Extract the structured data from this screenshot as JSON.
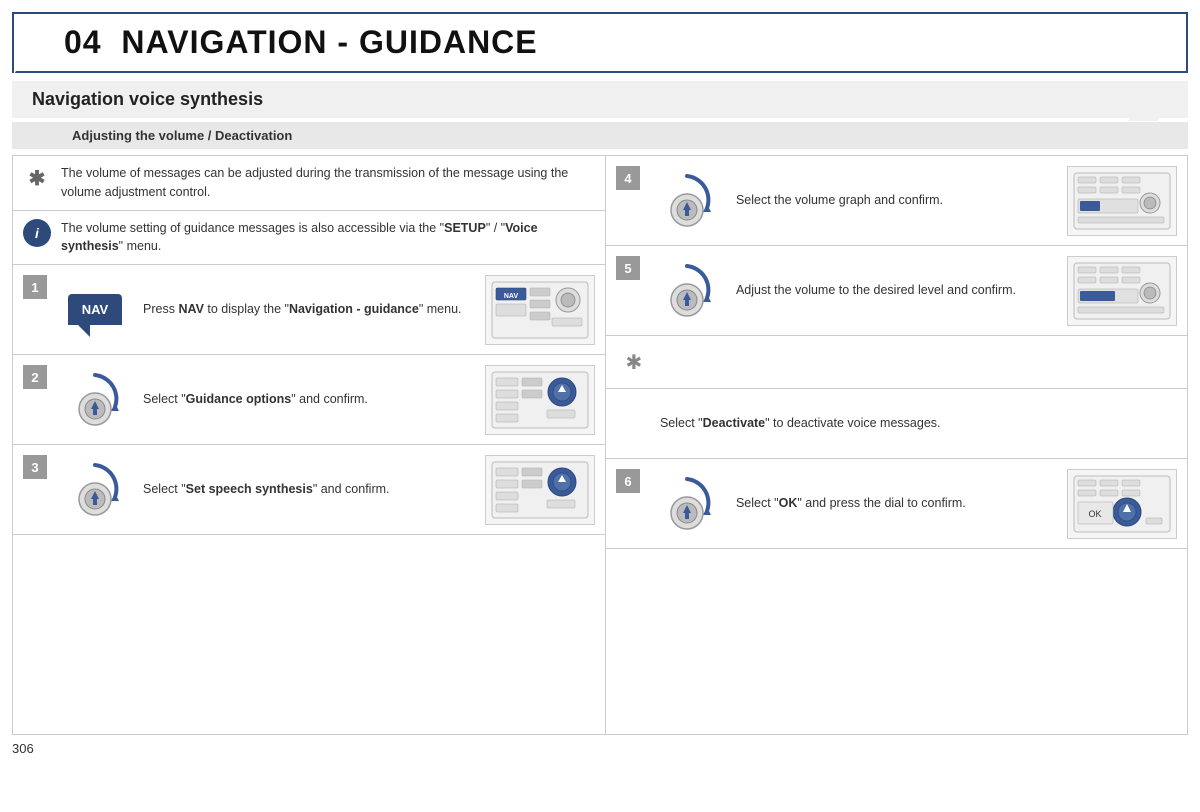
{
  "header": {
    "chapter": "04",
    "title": "NAVIGATION - GUIDANCE"
  },
  "section": {
    "title": "Navigation voice synthesis",
    "sub_title": "Adjusting the volume / Deactivation"
  },
  "info_rows": [
    {
      "icon": "sun",
      "text": "The volume of messages can be adjusted during the transmission of the message using the volume adjustment control."
    },
    {
      "icon": "i",
      "text_before": "The volume setting of guidance messages is also accessible via the \"",
      "setup": "SETUP",
      "text_mid": "\" / \"",
      "voice": "Voice synthesis",
      "text_end": "\" menu."
    }
  ],
  "left_steps": [
    {
      "num": "1",
      "text_before": "Press ",
      "bold": "NAV",
      "text_after": " to display the \"",
      "bold2": "Navigation - guidance",
      "text_end": "\" menu."
    },
    {
      "num": "2",
      "text_before": "Select \"",
      "bold": "Guidance options",
      "text_after": "\" and confirm."
    },
    {
      "num": "3",
      "text_before": "Select \"",
      "bold": "Set speech synthesis",
      "text_after": "\" and confirm."
    }
  ],
  "right_steps": [
    {
      "num": "4",
      "text_before": "Select the volume graph and confirm."
    },
    {
      "num": "5",
      "text_before": "Adjust the volume to the desired level and confirm."
    },
    {
      "deactivate_icon": true
    },
    {
      "text_before": "Select \"",
      "bold": "Deactivate",
      "text_after": "\" to deactivate voice messages."
    },
    {
      "num": "6",
      "text_before": "Select \"",
      "bold": "OK",
      "text_after": "\" and press the dial to confirm."
    }
  ],
  "page_number": "306"
}
